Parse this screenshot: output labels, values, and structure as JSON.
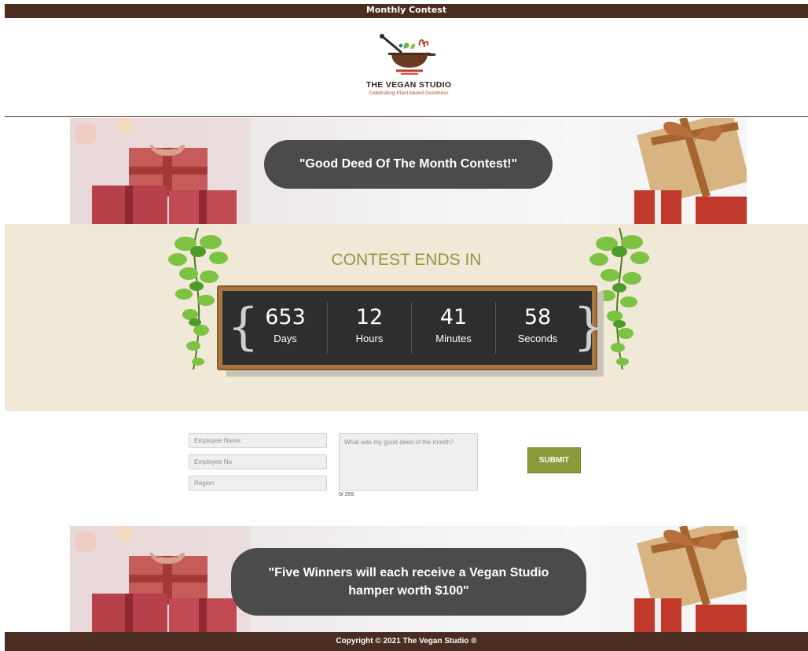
{
  "topbar": {
    "title": "Monthly Contest"
  },
  "logo": {
    "name": "THE VEGAN STUDIO",
    "tagline": "Celebrating Plant-based Goodness"
  },
  "banner_top": {
    "text": "\"Good Deed Of The Month Contest!\""
  },
  "countdown": {
    "title": "CONTEST ENDS IN",
    "days": "653",
    "days_label": "Days",
    "hours": "12",
    "hours_label": "Hours",
    "minutes": "41",
    "minutes_label": "Minutes",
    "seconds": "58",
    "seconds_label": "Seconds"
  },
  "form": {
    "employee_name_placeholder": "Employee Name",
    "employee_no_placeholder": "Employee No",
    "region_placeholder": "Region",
    "deed_placeholder": "What was my good deed of the month?",
    "char_counter": "0/ 255",
    "submit_label": "SUBMIT"
  },
  "banner_bottom": {
    "line1": "\"Five Winners will each receive a Vegan Studio",
    "line2": "hamper worth $100\""
  },
  "footer": {
    "text": "Copyright © 2021 The Vegan Studio ®"
  },
  "colors": {
    "brown": "#4a2c20",
    "olive": "#8c9a3a",
    "cream": "#f0e9d8",
    "pill": "#4b4b4b"
  }
}
